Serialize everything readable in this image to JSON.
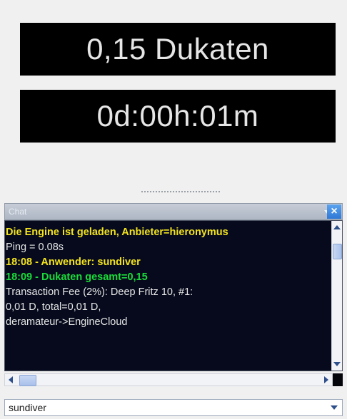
{
  "displays": {
    "cost": "0,15 Dukaten",
    "time": "0d:00h:01m"
  },
  "chat": {
    "title": "Chat",
    "lines": [
      "Die Engine ist geladen, Anbieter=hieronymus",
      "Ping = 0.08s",
      "18:08 - Anwender: sundiver",
      "18:09 - Dukaten gesamt=0,15",
      "Transaction Fee (2%): Deep Fritz 10, #1:",
      "0,01 D, total=0,01 D,",
      "deramateur->EngineCloud"
    ]
  },
  "input": {
    "value": "sundiver"
  },
  "icons": {
    "close": "close-icon",
    "menu": "chevron-down-icon",
    "dropdown": "chevron-down-icon"
  },
  "colors": {
    "display_bg": "#000000",
    "chat_bg": "#060a1c",
    "highlight_yellow": "#f4e41c",
    "highlight_green": "#19dd3a",
    "normal_text": "#e6e6e6"
  }
}
